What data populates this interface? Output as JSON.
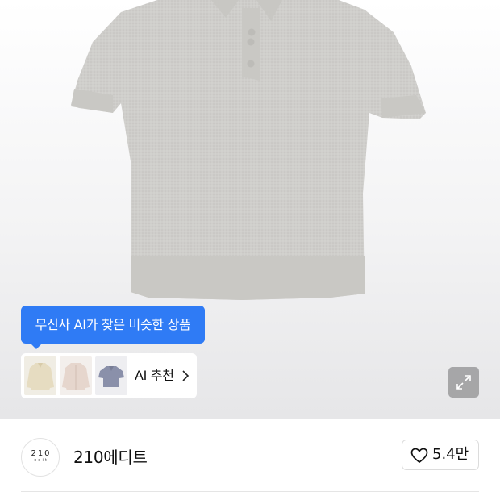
{
  "ai_recommend": {
    "tooltip": "무신사 AI가 찾은 비슷한 상품",
    "label": "AI 추천",
    "thumbnails": [
      "beige-knit-thumbnail",
      "pink-cardigan-thumbnail",
      "blue-polo-thumbnail"
    ]
  },
  "brand": {
    "logo_top": "210",
    "logo_bottom": "edit",
    "name": "210에디트"
  },
  "like": {
    "count": "5.4만"
  },
  "colors": {
    "accent": "#2f7bf5",
    "product_gray": "#cfcecb"
  },
  "icons": [
    "expand-icon",
    "heart-icon",
    "chevron-right-icon"
  ]
}
